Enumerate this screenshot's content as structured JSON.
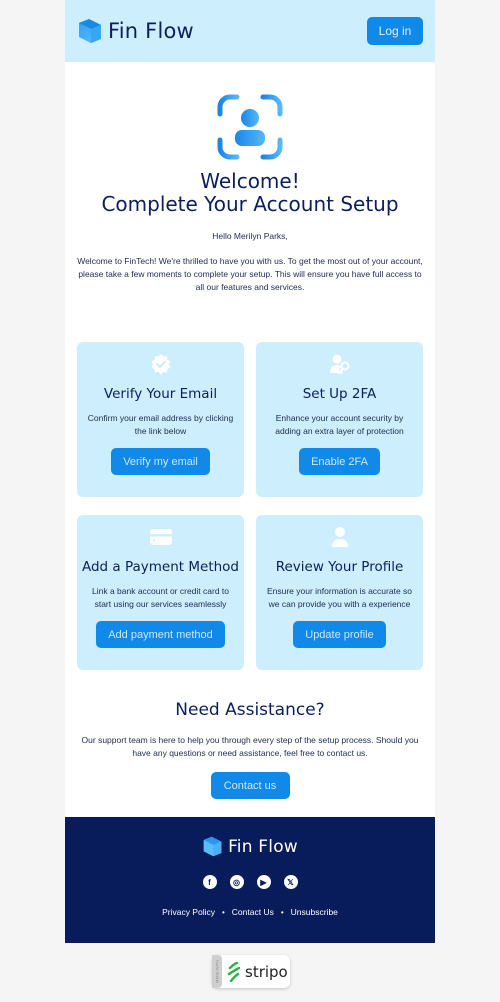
{
  "header": {
    "brand": "Fin Flow",
    "login_label": "Log in"
  },
  "hero": {
    "icon": "user-scan-icon",
    "title_line1": "Welcome!",
    "title_line2": "Complete Your Account Setup",
    "greeting": "Hello Merilyn Parks,",
    "intro": "Welcome to FinTech! We're thrilled to have you with us. To get the most out of your account, please take a few moments to complete your setup. This will ensure you have full access to all our features and services."
  },
  "cards": [
    {
      "icon": "verified-badge-icon",
      "title": "Verify Your Email",
      "desc": "Confirm your email address by clicking the link below",
      "button": "Verify my email"
    },
    {
      "icon": "user-key-icon",
      "title": "Set Up 2FA",
      "desc": "Enhance your account security by adding an extra layer of protection",
      "button": "Enable 2FA"
    },
    {
      "icon": "credit-card-icon",
      "title": "Add a Payment Method",
      "desc": "Link a bank account or credit card to start using our services seamlessly",
      "button": "Add payment method"
    },
    {
      "icon": "user-icon",
      "title": "Review Your Profile",
      "desc": "Ensure your information is accurate so we can provide you with a experience",
      "button": "Update profile"
    }
  ],
  "assist": {
    "title": "Need Assistance?",
    "desc": "Our support team is here to help you through every step of the setup process. Should you have any questions or need assistance, feel free to contact us.",
    "button": "Contact us"
  },
  "footer": {
    "brand": "Fin Flow",
    "social": [
      "facebook-icon",
      "instagram-icon",
      "youtube-icon",
      "x-icon"
    ],
    "links": [
      "Privacy Policy",
      "Contact Us",
      "Unsubscribe"
    ],
    "separator": "•"
  },
  "badge": {
    "side_text": "MADE WITH",
    "brand": "stripo"
  },
  "colors": {
    "accent": "#1089e8",
    "header_bg": "#cdeefd",
    "footer_bg": "#081b5a",
    "text": "#0b1f5c"
  }
}
